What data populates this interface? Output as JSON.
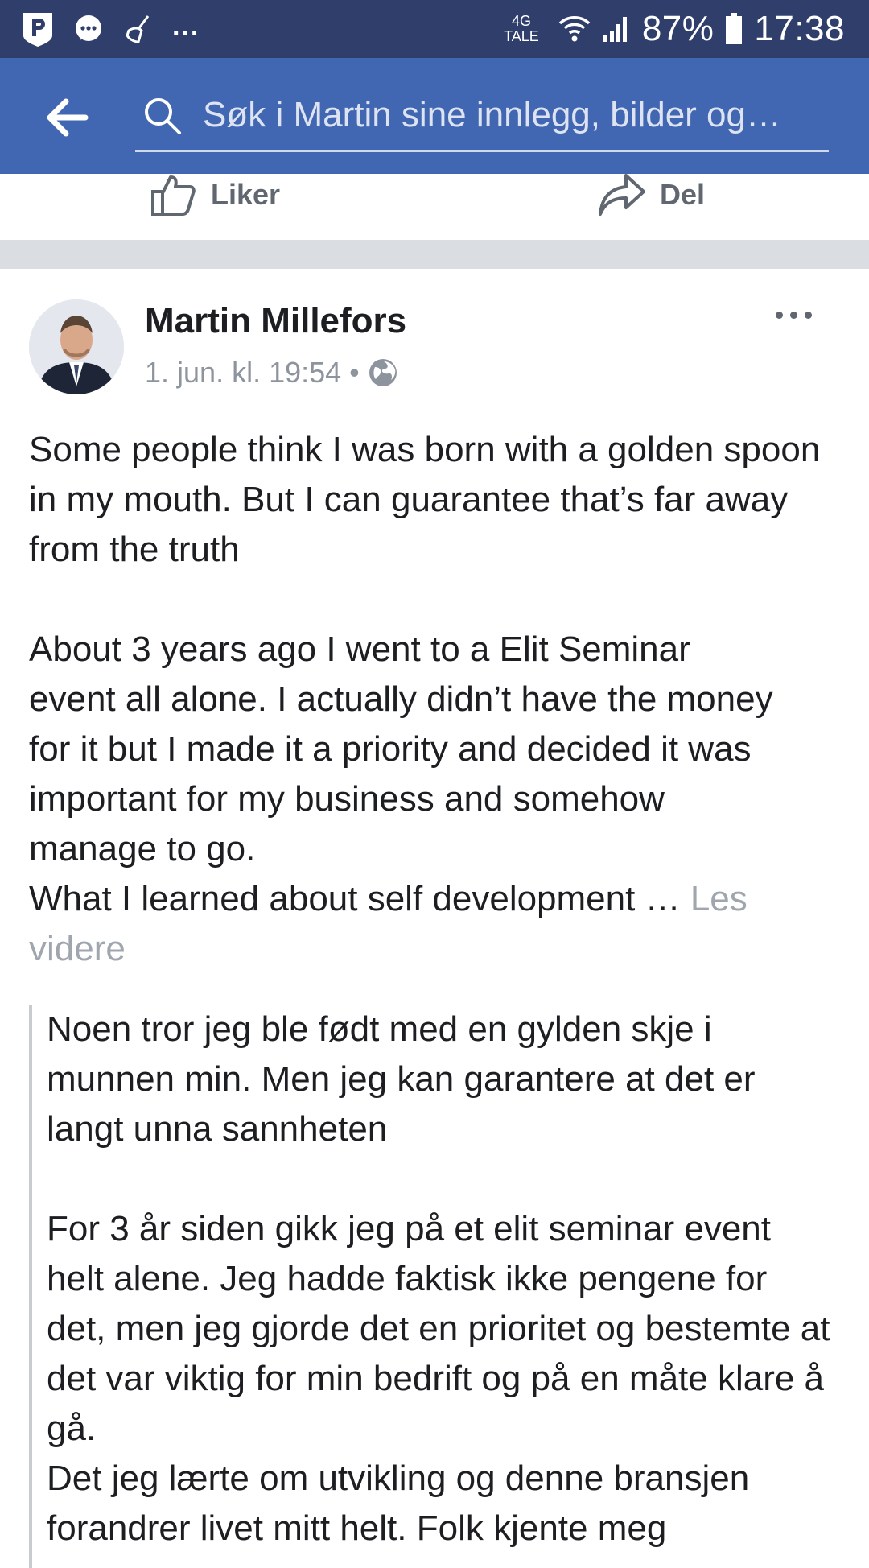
{
  "status_bar": {
    "network_top": "4G",
    "network_bottom": "TALE",
    "battery": "87%",
    "time": "17:38",
    "overflow": "..."
  },
  "header": {
    "search_placeholder": "Søk i Martin sine innlegg, bilder og…"
  },
  "actions": {
    "like_label": "Liker",
    "share_label": "Del"
  },
  "post": {
    "author": "Martin Millefors",
    "timestamp": "1. jun. kl. 19:54",
    "separator": "•",
    "paragraph1": "Some people think I was born with a golden spoon in my mouth. But I can guarantee that’s far away from the truth",
    "paragraph2_lines": [
      "About 3 years ago I went to a Elit Seminar",
      "event all alone. I actually didn’t have the money",
      "for it but I made it a priority and decided it was",
      "important for my business and somehow",
      "manage to go."
    ],
    "paragraph3": "What I learned about self development … ",
    "see_more": "Les videre",
    "translation_p1": "Noen tror jeg ble født med en gylden skje i munnen min. Men jeg kan garantere at det er langt unna sannheten",
    "translation_p2": "For 3 år siden gikk jeg på et elit seminar event helt alene. Jeg hadde faktisk ikke pengene for det, men jeg gjorde det en prioritet og bestemte at det var viktig for min bedrift og på en måte klare å gå.",
    "translation_p3": "Det jeg lærte om utvikling og denne bransjen forandrer livet mitt helt. Folk kjente meg"
  },
  "colors": {
    "status_bar": "#2f3e6b",
    "app_bar": "#4267b2",
    "divider": "#dadde1",
    "meta_text": "#8d949e"
  }
}
